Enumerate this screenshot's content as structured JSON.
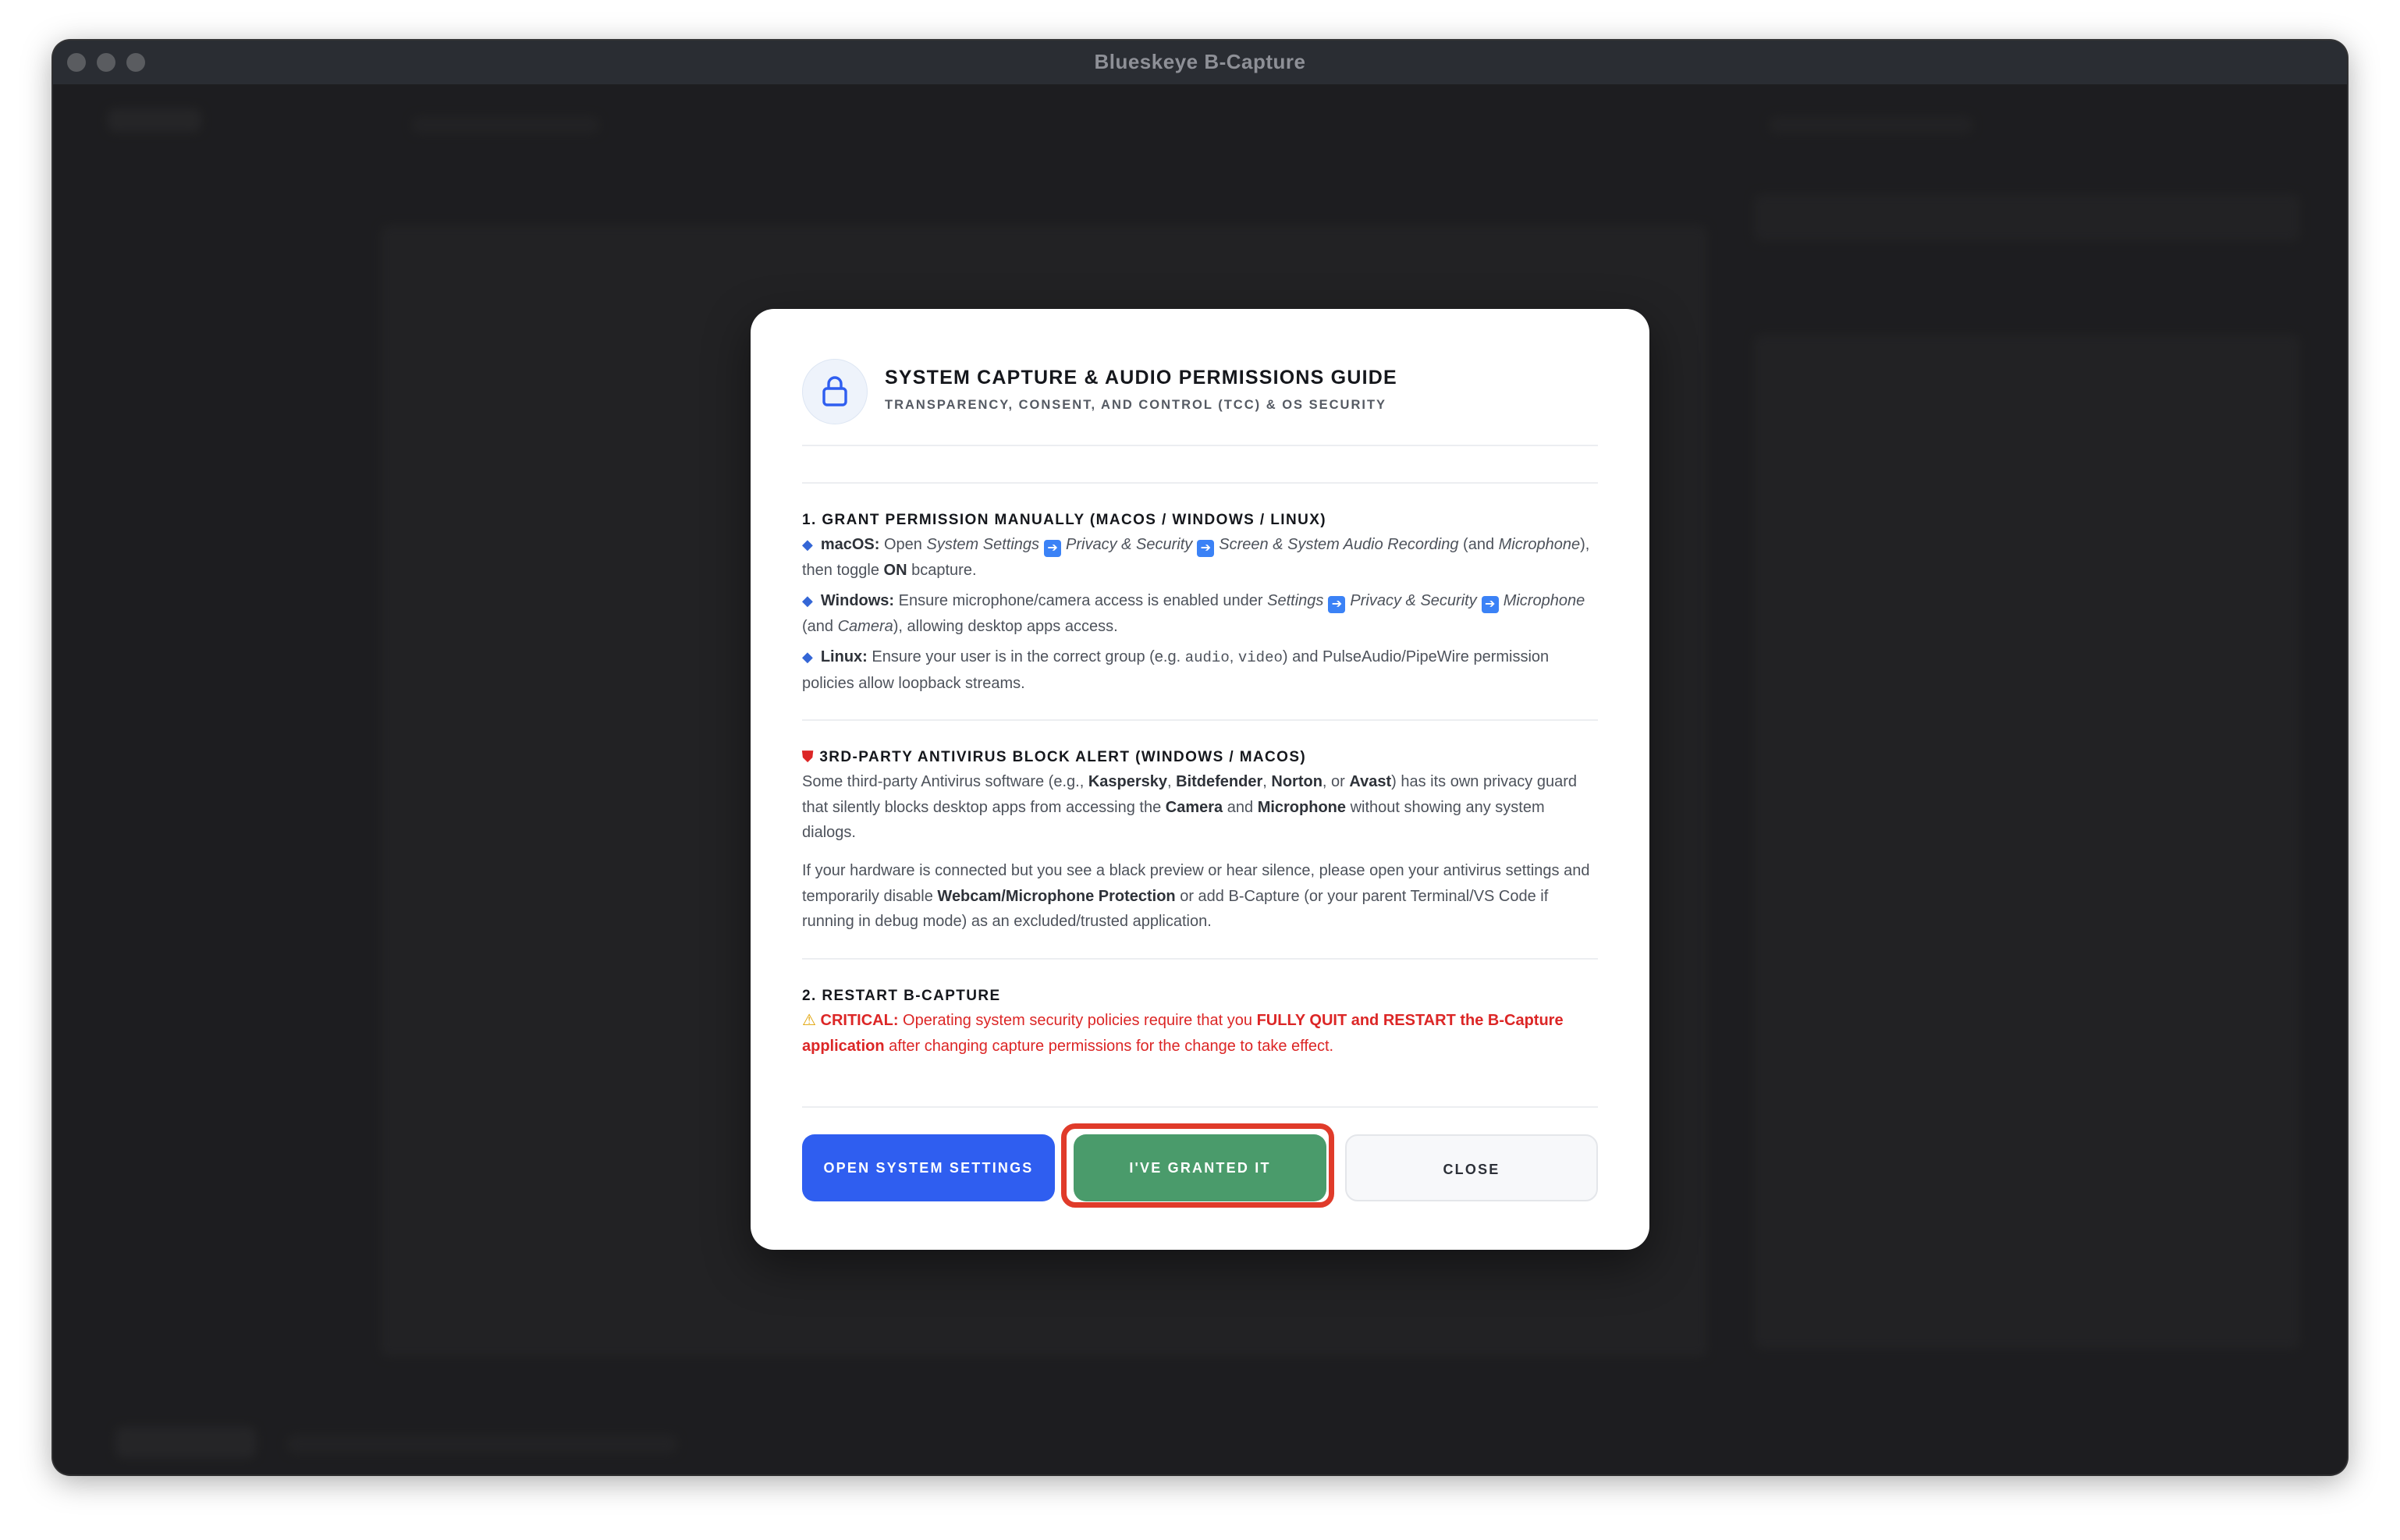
{
  "window": {
    "title": "Blueskeye B-Capture"
  },
  "dialog": {
    "title": "SYSTEM CAPTURE & AUDIO PERMISSIONS GUIDE",
    "subtitle": "TRANSPARENCY, CONSENT, AND CONTROL (TCC) & OS SECURITY",
    "icon": "lock-icon",
    "section1": {
      "title": "1. GRANT PERMISSION MANUALLY (MACOS / WINDOWS / LINUX)",
      "macos": {
        "label": "macOS:",
        "t1": "Open",
        "settings": "System Settings",
        "privacy": "Privacy & Security",
        "screen": "Screen & System Audio Recording",
        "t2": "(and",
        "mic": "Microphone",
        "t3": "), then toggle",
        "on": "ON",
        "t4": "bcapture."
      },
      "windows": {
        "label": "Windows:",
        "t1": "Ensure microphone/camera access is enabled under",
        "settings": "Settings",
        "privacy": "Privacy & Security",
        "mic": "Microphone",
        "t2": "(and",
        "camera": "Camera",
        "t3": "), allowing desktop apps access."
      },
      "linux": {
        "label": "Linux:",
        "t1": "Ensure your user is in the correct group (e.g.",
        "audio": "audio",
        "comma": ",",
        "video": "video",
        "t2": ") and PulseAudio/PipeWire permission policies allow loopback streams."
      }
    },
    "antivirus": {
      "title": "3RD-PARTY ANTIVIRUS BLOCK ALERT (WINDOWS / MACOS)",
      "p1": {
        "t1": "Some third-party Antivirus software (e.g.,",
        "kaspersky": "Kaspersky",
        "c1": ",",
        "bitdefender": "Bitdefender",
        "c2": ",",
        "norton": "Norton",
        "c3": ", or",
        "avast": "Avast",
        "t2": ") has its own privacy guard that silently blocks desktop apps from accessing the",
        "camera": "Camera",
        "and": "and",
        "microphone": "Microphone",
        "t3": "without showing any system dialogs."
      },
      "p2": {
        "t1": "If your hardware is connected but you see a black preview or hear silence, please open your antivirus settings and temporarily disable",
        "protection": "Webcam/Microphone Protection",
        "t2": "or add B-Capture (or your parent Terminal/VS Code if running in debug mode) as an excluded/trusted application."
      }
    },
    "section2": {
      "title": "2. RESTART B-CAPTURE",
      "critical_label": "CRITICAL:",
      "t1": "Operating system security policies require that you",
      "emph": "FULLY QUIT and RESTART the B-Capture application",
      "t2": "after changing capture permissions for the change to take effect."
    },
    "buttons": {
      "open_settings": "OPEN SYSTEM SETTINGS",
      "granted": "I'VE GRANTED IT",
      "close": "CLOSE"
    }
  },
  "colors": {
    "primary": "#2f5ef0",
    "success": "#4a9b6b",
    "critical": "#dc2626",
    "highlight": "#e03b2a"
  }
}
